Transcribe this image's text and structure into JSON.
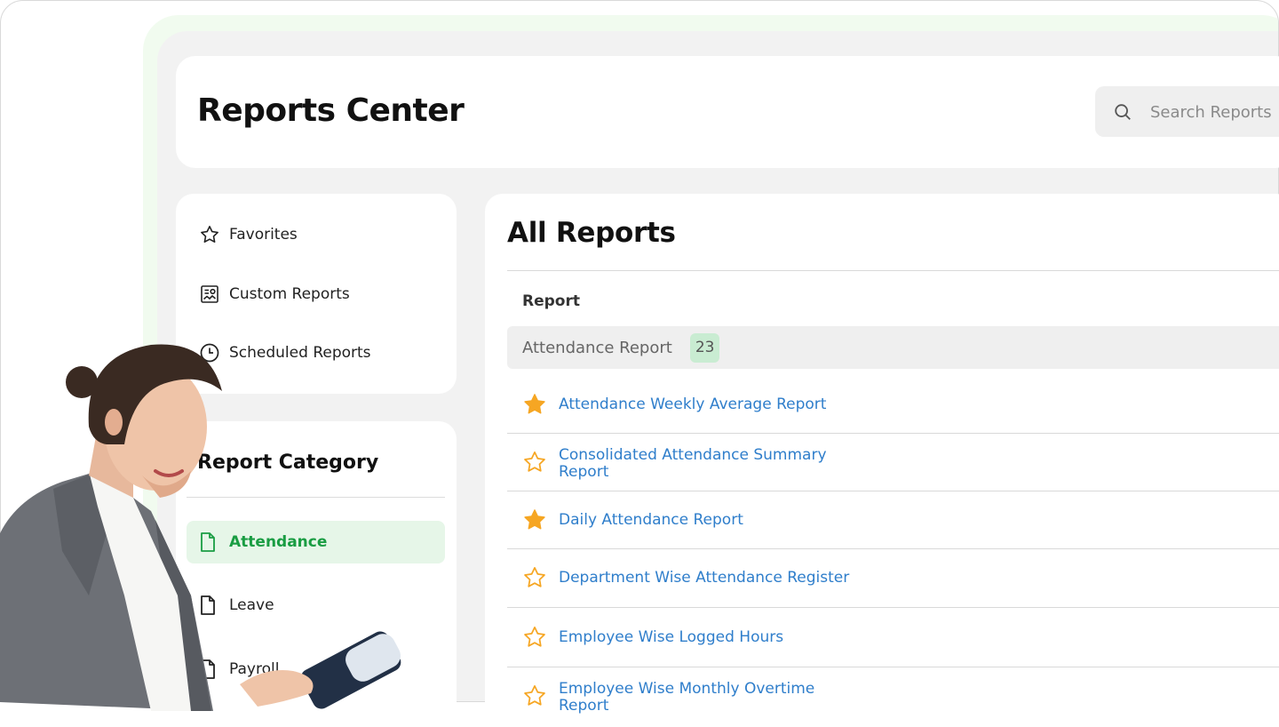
{
  "header": {
    "title": "Reports Center",
    "search_placeholder": "Search Reports"
  },
  "quick_nav": [
    {
      "label": "Favorites",
      "icon": "star-outline-icon"
    },
    {
      "label": "Custom Reports",
      "icon": "custom-report-icon"
    },
    {
      "label": "Scheduled Reports",
      "icon": "clock-icon"
    }
  ],
  "category": {
    "title": "Report Category",
    "items": [
      {
        "label": "Attendance",
        "active": true
      },
      {
        "label": "Leave",
        "active": false
      },
      {
        "label": "Payroll",
        "active": false
      }
    ]
  },
  "reports": {
    "title": "All Reports",
    "column_header": "Report",
    "group": {
      "name": "Attendance Report",
      "count": "23"
    },
    "items": [
      {
        "label": "Attendance Weekly Average Report",
        "favorite": true
      },
      {
        "label": "Consolidated Attendance Summary Report",
        "favorite": false
      },
      {
        "label": "Daily Attendance Report",
        "favorite": true
      },
      {
        "label": "Department Wise Attendance Register",
        "favorite": false
      },
      {
        "label": "Employee Wise Logged Hours",
        "favorite": false
      },
      {
        "label": "Employee Wise Monthly Overtime Report",
        "favorite": false
      }
    ]
  },
  "colors": {
    "accent_green": "#1a9d43",
    "active_bg": "#e6f6e8",
    "link_blue": "#2f7ecb",
    "star_gold": "#f6a623",
    "badge_bg": "#c9ecd2"
  }
}
